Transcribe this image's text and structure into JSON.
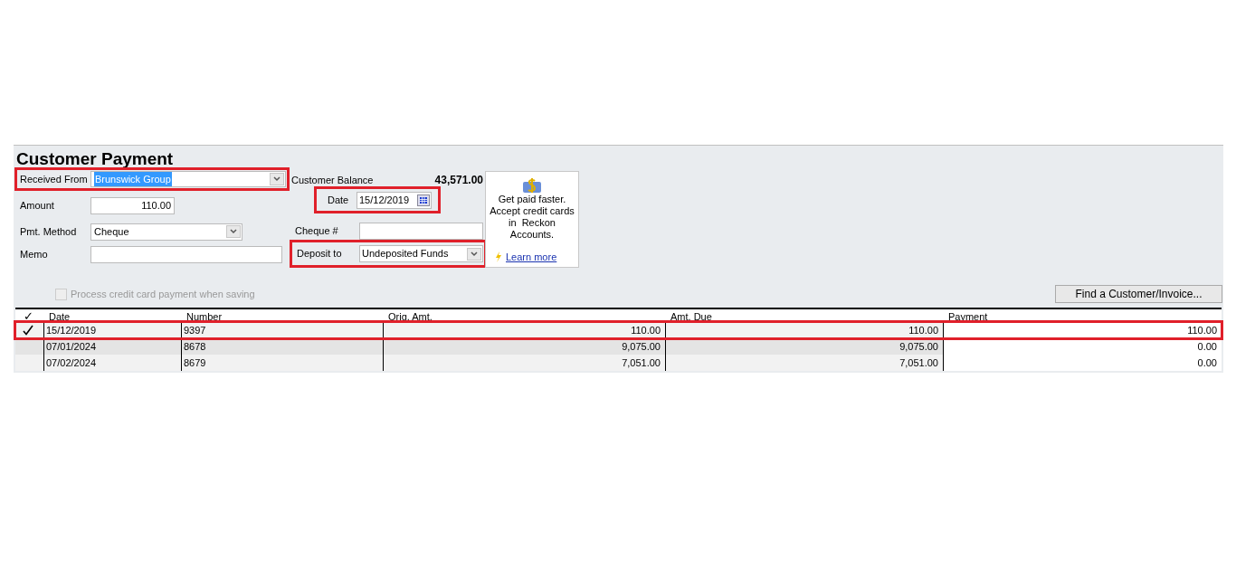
{
  "title": "Customer Payment",
  "received_from": {
    "label": "Received From",
    "value": "Brunswick Group",
    "highlighted": true
  },
  "amount": {
    "label": "Amount",
    "value": "110.00"
  },
  "pmt_method": {
    "label": "Pmt. Method",
    "value": "Cheque"
  },
  "memo": {
    "label": "Memo"
  },
  "customer_balance": {
    "label": "Customer Balance",
    "value": "43,571.00"
  },
  "date": {
    "label": "Date",
    "value": "15/12/2019",
    "highlighted": true
  },
  "cheque_no": {
    "label": "Cheque #"
  },
  "deposit_to": {
    "label": "Deposit to",
    "value": "Undeposited Funds",
    "highlighted": true
  },
  "promo": {
    "text": "Get paid faster. Accept credit cards in  Reckon Accounts.",
    "link": "Learn more"
  },
  "process_cc": {
    "label": "Process credit card payment when saving",
    "checked": false,
    "disabled": true
  },
  "find_button": "Find a Customer/Invoice...",
  "table": {
    "check_header": "✓",
    "columns": [
      "Date",
      "Number",
      "Orig. Amt.",
      "Amt. Due",
      "Payment"
    ],
    "rows": [
      {
        "checked": true,
        "highlighted": true,
        "cells": [
          "15/12/2019",
          "9397",
          "110.00",
          "110.00",
          "110.00"
        ]
      },
      {
        "checked": false,
        "highlighted": false,
        "cells": [
          "07/01/2024",
          "8678",
          "9,075.00",
          "9,075.00",
          "0.00"
        ]
      },
      {
        "checked": false,
        "highlighted": false,
        "cells": [
          "07/02/2024",
          "8679",
          "7,051.00",
          "7,051.00",
          "0.00"
        ]
      }
    ]
  }
}
